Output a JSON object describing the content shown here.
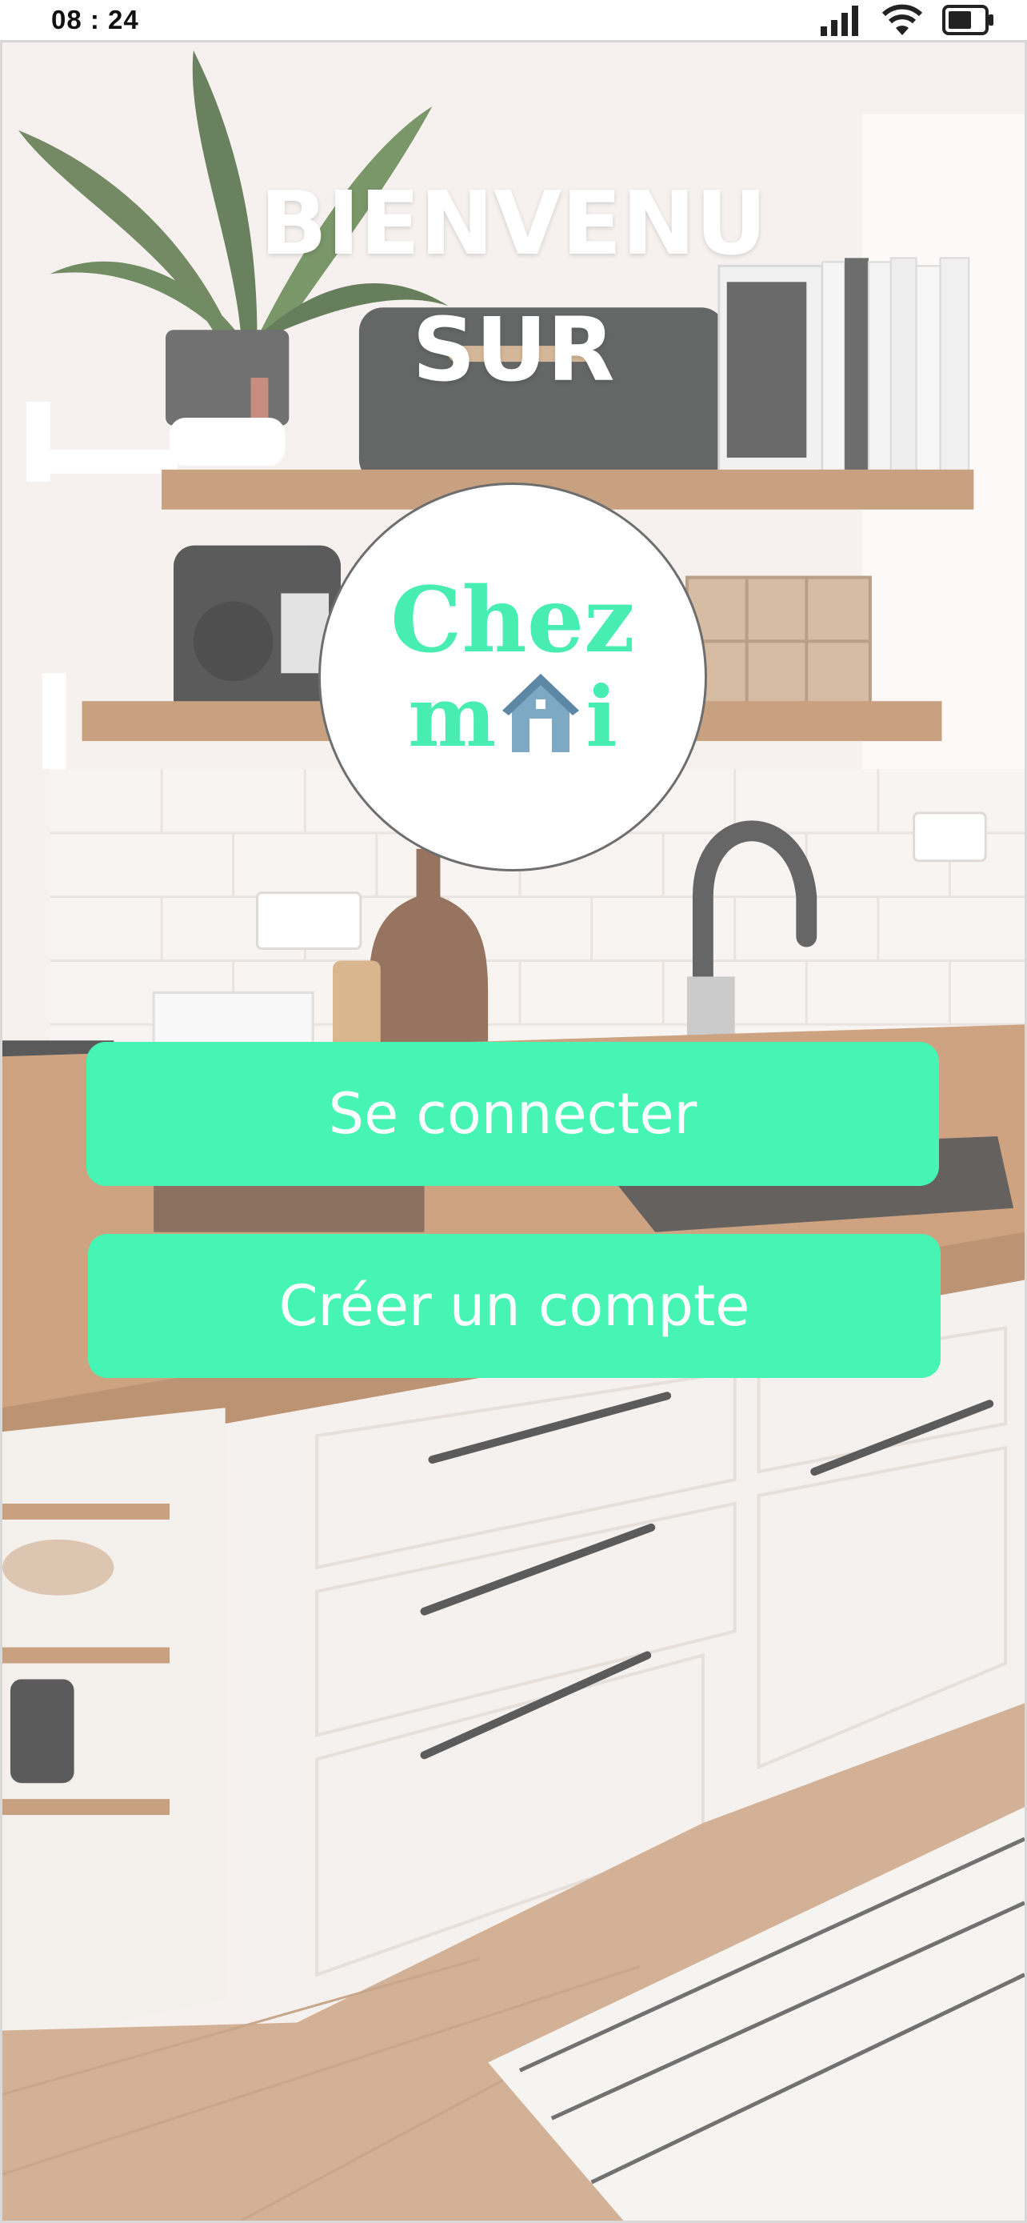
{
  "status_bar": {
    "time": "08 : 24"
  },
  "welcome": {
    "line1": "BIENVENU",
    "line2": "SUR"
  },
  "logo": {
    "line1": "Chez",
    "line2_start": "m",
    "line2_end": "i",
    "accent_color": "#47edb1",
    "house_color": "#7ea9c4"
  },
  "actions": {
    "login_label": "Se connecter",
    "signup_label": "Créer un compte",
    "button_color": "#46f5b3"
  }
}
